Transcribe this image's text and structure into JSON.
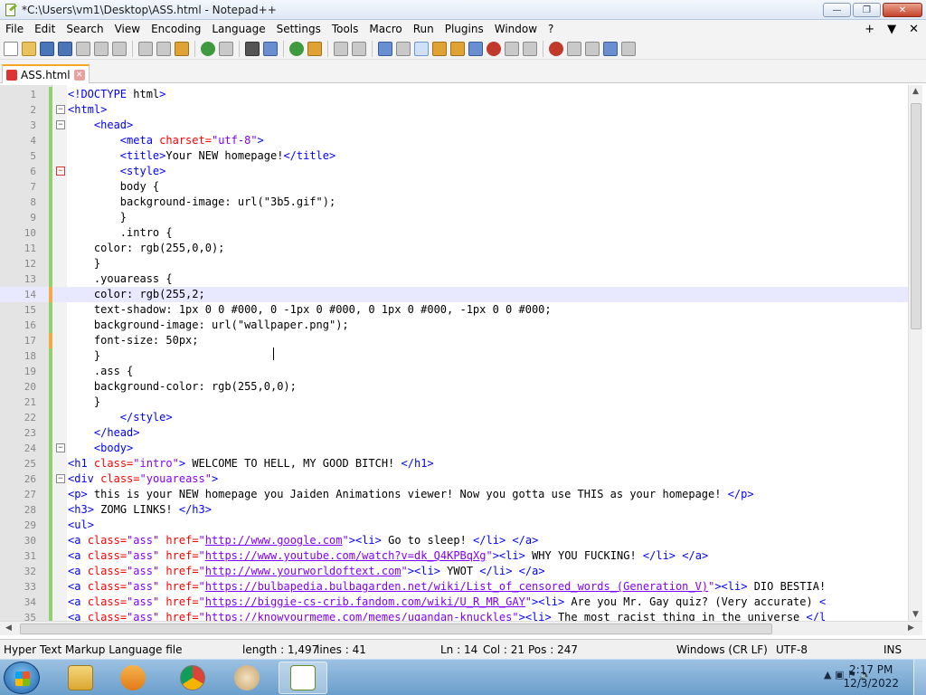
{
  "window": {
    "title": "*C:\\Users\\vm1\\Desktop\\ASS.html - Notepad++",
    "buttons": {
      "minimize": "—",
      "maximize": "❐",
      "close": "✕"
    }
  },
  "menu": {
    "items": [
      "File",
      "Edit",
      "Search",
      "View",
      "Encoding",
      "Language",
      "Settings",
      "Tools",
      "Macro",
      "Run",
      "Plugins",
      "Window",
      "?"
    ],
    "right": {
      "plus": "+",
      "down": "▼",
      "close": "✕"
    }
  },
  "toolbar": {
    "icons": [
      "new-file-icon",
      "open-file-icon",
      "save-icon",
      "save-all-icon",
      "close-icon",
      "close-all-icon",
      "print-icon",
      "cut-icon",
      "copy-icon",
      "paste-icon",
      "undo-icon",
      "redo-icon",
      "find-icon",
      "replace-icon",
      "zoom-in-icon",
      "zoom-out-icon",
      "sync-vertical-icon",
      "sync-horizontal-icon",
      "word-wrap-icon",
      "show-all-chars-icon",
      "indent-guide-icon",
      "udl-icon",
      "doc-map-icon",
      "function-list-icon",
      "folder-workspace-icon",
      "monitoring-icon",
      "record-macro-icon",
      "stop-macro-icon",
      "play-macro-icon",
      "run-macro-multiple-icon",
      "save-macro-icon"
    ]
  },
  "tab": {
    "label": "ASS.html",
    "close": "✕"
  },
  "editor": {
    "current_line": 14,
    "lines": [
      {
        "n": "1",
        "text": "<!DOCTYPE html>"
      },
      {
        "n": "2",
        "text": "<html>"
      },
      {
        "n": "3",
        "text": "    <head>"
      },
      {
        "n": "4",
        "text": "        <meta charset=\"utf-8\">"
      },
      {
        "n": "5",
        "text": "        <title>Your NEW homepage!</title>"
      },
      {
        "n": "6",
        "text": "        <style>"
      },
      {
        "n": "7",
        "text": "        body {"
      },
      {
        "n": "8",
        "text": "        background-image: url(\"3b5.gif\");"
      },
      {
        "n": "9",
        "text": "        }"
      },
      {
        "n": "10",
        "text": "        .intro {"
      },
      {
        "n": "11",
        "text": "    color: rgb(255,0,0);"
      },
      {
        "n": "12",
        "text": "    }"
      },
      {
        "n": "13",
        "text": "    .youareass {"
      },
      {
        "n": "14",
        "text": "    color: rgb(255,2;"
      },
      {
        "n": "15",
        "text": "    text-shadow: 1px 0 0 #000, 0 -1px 0 #000, 0 1px 0 #000, -1px 0 0 #000;"
      },
      {
        "n": "16",
        "text": "    background-image: url(\"wallpaper.png\");"
      },
      {
        "n": "17",
        "text": "    font-size: 50px;"
      },
      {
        "n": "18",
        "text": "    }"
      },
      {
        "n": "19",
        "text": "    .ass {"
      },
      {
        "n": "20",
        "text": "    background-color: rgb(255,0,0);"
      },
      {
        "n": "21",
        "text": "    }"
      },
      {
        "n": "22",
        "text": "        </style>"
      },
      {
        "n": "23",
        "text": "    </head>"
      },
      {
        "n": "24",
        "text": "    <body>"
      },
      {
        "n": "25",
        "text": "<h1 class=\"intro\"> WELCOME TO HELL, MY GOOD BITCH! </h1>"
      },
      {
        "n": "26",
        "text": "<div class=\"youareass\">"
      },
      {
        "n": "27",
        "text": "<p> this is your NEW homepage you Jaiden Animations viewer! Now you gotta use THIS as your homepage! </p>"
      },
      {
        "n": "28",
        "text": "<h3> ZOMG LINKS! </h3>"
      },
      {
        "n": "29",
        "text": "<ul>"
      },
      {
        "n": "30",
        "text": "<a class=\"ass\" href=\"http://www.google.com\"><li> Go to sleep! </li> </a>"
      },
      {
        "n": "31",
        "text": "<a class=\"ass\" href=\"https://www.youtube.com/watch?v=dk_Q4KPBqXg\"><li> WHY YOU FUCKING! </li> </a>"
      },
      {
        "n": "32",
        "text": "<a class=\"ass\" href=\"http://www.yourworldoftext.com\"><li> YWOT </li> </a>"
      },
      {
        "n": "33",
        "text": "<a class=\"ass\" href=\"https://bulbapedia.bulbagarden.net/wiki/List_of_censored_words_(Generation_V)\"><li> DIO BESTIA!"
      },
      {
        "n": "34",
        "text": "<a class=\"ass\" href=\"https://biggie-cs-crib.fandom.com/wiki/U_R_MR_GAY\"><li> Are you Mr. Gay quiz? (Very accurate) <"
      },
      {
        "n": "35",
        "text": "<a class=\"ass\" href=\"https://knowyourmeme.com/memes/ugandan-knuckles\"><li> The most racist thing in the universe </l"
      }
    ]
  },
  "status": {
    "filetype": "Hyper Text Markup Language file",
    "length": "length : 1,497",
    "lines": "lines : 41",
    "ln": "Ln : 14",
    "col": "Col : 21",
    "pos": "Pos : 247",
    "eol": "Windows (CR LF)",
    "encoding": "UTF-8",
    "mode": "INS"
  },
  "taskbar": {
    "time": "2:17 PM",
    "date": "12/3/2022",
    "apps": [
      "explorer-icon",
      "media-player-icon",
      "chrome-icon",
      "paint-icon",
      "notepad-plus-plus-icon"
    ],
    "tray_icons": [
      "show-hidden-icon",
      "network-icon",
      "action-center-icon",
      "volume-icon"
    ]
  }
}
